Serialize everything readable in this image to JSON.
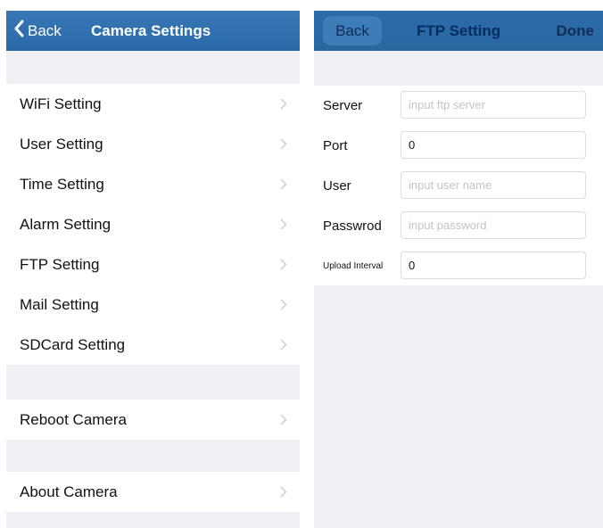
{
  "left_panel": {
    "nav": {
      "back_label": "Back",
      "title": "Camera Settings"
    },
    "group1": [
      {
        "label": "WiFi Setting"
      },
      {
        "label": "User Setting"
      },
      {
        "label": "Time Setting"
      },
      {
        "label": "Alarm Setting"
      },
      {
        "label": "FTP Setting"
      },
      {
        "label": "Mail Setting"
      },
      {
        "label": "SDCard Setting"
      }
    ],
    "reboot": {
      "label": "Reboot Camera"
    },
    "about": {
      "label": "About Camera"
    }
  },
  "right_panel": {
    "nav": {
      "back_label": "Back",
      "title": "FTP Setting",
      "done_label": "Done"
    },
    "fields": {
      "server": {
        "label": "Server",
        "value": "",
        "placeholder": "input ftp server"
      },
      "port": {
        "label": "Port",
        "value": "0",
        "placeholder": ""
      },
      "user": {
        "label": "User",
        "value": "",
        "placeholder": "input user name"
      },
      "password": {
        "label": "Passwrod",
        "value": "",
        "placeholder": "input password"
      },
      "upload_interval": {
        "label": "Upload Interval",
        "value": "0",
        "placeholder": ""
      }
    }
  },
  "colors": {
    "nav_blue": "#2e6fae",
    "group_bg": "#efeff4",
    "chevron": "#c7c7cc"
  }
}
